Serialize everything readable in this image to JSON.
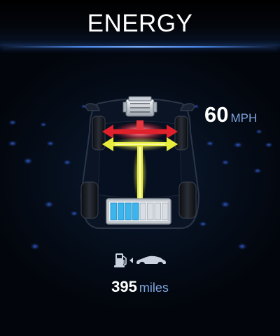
{
  "header": {
    "title": "ENERGY"
  },
  "speed": {
    "value": "60",
    "unit": "MPH"
  },
  "range": {
    "value": "395",
    "unit": "miles"
  },
  "battery": {
    "level": 0.5,
    "total_cells": 8,
    "filled_cells": 4
  },
  "energy_flow": {
    "active_path": "battery-to-wheels",
    "colors": {
      "flow": "#e8ec3a",
      "front_axle": "#e0202a",
      "battery_cell_filled": "#3cb4ec",
      "battery_cell_empty": "#d8dde3",
      "accent": "#4f8cf0"
    }
  },
  "icons": [
    "fuel-pump-icon",
    "arrow-left-icon",
    "car-icon"
  ]
}
